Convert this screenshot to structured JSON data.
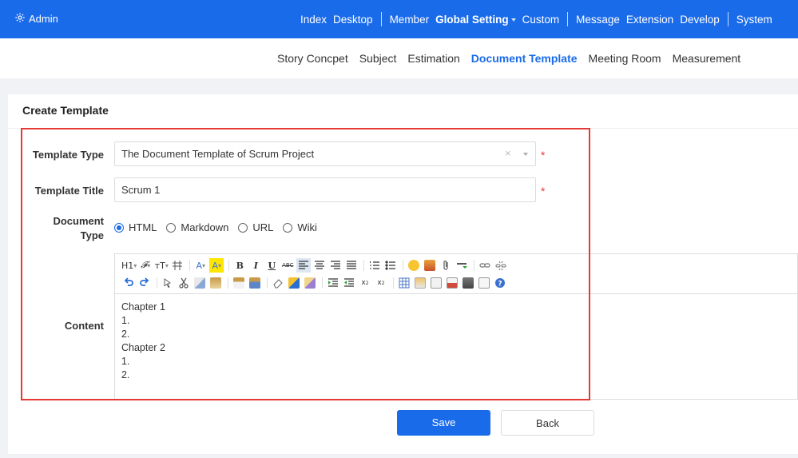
{
  "header": {
    "brand": "Admin",
    "nav": [
      {
        "label": "Index",
        "active": false
      },
      {
        "label": "Desktop",
        "active": false
      },
      {
        "sep": true
      },
      {
        "label": "Member",
        "active": false
      },
      {
        "label": "Global Setting",
        "active": true,
        "dropdown": true
      },
      {
        "label": "Custom",
        "active": false
      },
      {
        "sep": true
      },
      {
        "label": "Message",
        "active": false
      },
      {
        "label": "Extension",
        "active": false
      },
      {
        "label": "Develop",
        "active": false
      },
      {
        "sep": true
      },
      {
        "label": "System",
        "active": false
      }
    ]
  },
  "subnav": [
    {
      "label": "Story Concpet",
      "active": false
    },
    {
      "label": "Subject",
      "active": false
    },
    {
      "label": "Estimation",
      "active": false
    },
    {
      "label": "Document Template",
      "active": true
    },
    {
      "label": "Meeting Room",
      "active": false
    },
    {
      "label": "Measurement",
      "active": false
    }
  ],
  "form": {
    "title": "Create Template",
    "template_type_label": "Template Type",
    "template_type_value": "The Document Template of Scrum Project",
    "template_title_label": "Template Title",
    "template_title_value": "Scrum 1",
    "doc_type_label_1": "Document",
    "doc_type_label_2": "Type",
    "doc_types": [
      {
        "label": "HTML",
        "checked": true
      },
      {
        "label": "Markdown",
        "checked": false
      },
      {
        "label": "URL",
        "checked": false
      },
      {
        "label": "Wiki",
        "checked": false
      }
    ],
    "content_label": "Content",
    "content_lines": [
      "Chapter 1",
      "1.",
      "2.",
      "Chapter 2",
      "1.",
      "2."
    ],
    "required_mark": "*",
    "clear_mark": "×"
  },
  "toolbar": {
    "h1": "H1",
    "font": "𝓕",
    "size": "тT",
    "bold": "B",
    "italic": "I",
    "underline": "U",
    "strike": "ABC",
    "font_color": "A",
    "bg_color": "A"
  },
  "buttons": {
    "save": "Save",
    "back": "Back"
  },
  "colors": {
    "primary": "#1a6bea",
    "required": "#e53935",
    "highlight": "#e53935"
  }
}
